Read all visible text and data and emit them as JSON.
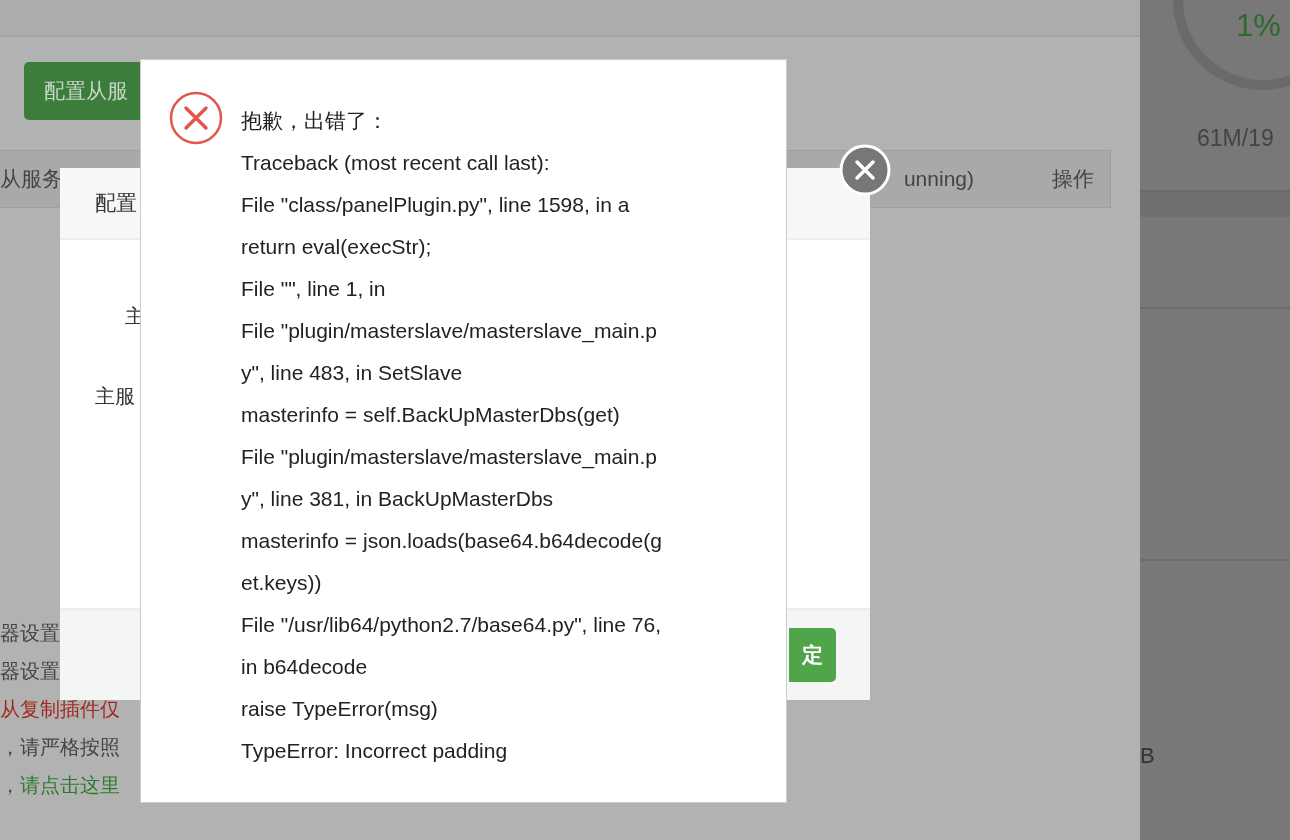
{
  "page": {
    "config_button": "配置从服",
    "table_headers": [
      "从服务",
      "unning)",
      "操作"
    ],
    "notes": [
      {
        "kind": "plain",
        "text": "器设置"
      },
      {
        "kind": "plain",
        "text": "器设置"
      },
      {
        "kind": "warning",
        "text": "从复制插件仅"
      },
      {
        "kind": "plain",
        "text": "，请严格按照"
      },
      {
        "kind": "link",
        "text": "，",
        "link": "请点击这里"
      }
    ]
  },
  "side_panel": {
    "usage": "1%",
    "memory": "61M/19",
    "footer_fragment": "B"
  },
  "config_dialog": {
    "title": "配置",
    "labels": [
      "主",
      "主服"
    ],
    "confirm_button": "定"
  },
  "error_dialog": {
    "heading": "抱歉，出错了：",
    "lines": [
      "Traceback (most recent call last):",
      "File \"class/panelPlugin.py\", line 1598, in a",
      "return eval(execStr);",
      "File \"\", line 1, in",
      "File \"plugin/masterslave/masterslave_main.p",
      "y\", line 483, in SetSlave",
      "masterinfo = self.BackUpMasterDbs(get)",
      "File \"plugin/masterslave/masterslave_main.p",
      "y\", line 381, in BackUpMasterDbs",
      "masterinfo = json.loads(base64.b64decode(g",
      "et.keys))",
      "File \"/usr/lib64/python2.7/base64.py\", line 76,",
      "in b64decode",
      "raise TypeError(msg)",
      "TypeError: Incorrect padding"
    ]
  }
}
